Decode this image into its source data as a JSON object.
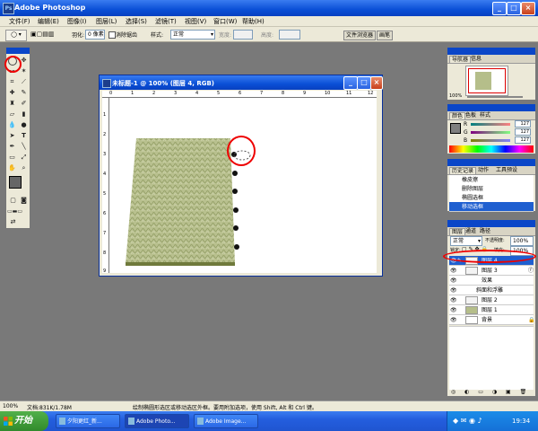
{
  "app": {
    "title": "Adobe Photoshop",
    "icon": "photoshop-logo"
  },
  "menubar": [
    "文件(F)",
    "编辑(E)",
    "图像(I)",
    "图层(L)",
    "选择(S)",
    "滤镜(T)",
    "视图(V)",
    "窗口(W)",
    "帮助(H)"
  ],
  "options": {
    "feather_label": "羽化:",
    "feather_value": "0 像素",
    "antialias_label": "消除锯齿",
    "style_label": "样式:",
    "style_value": "正常",
    "width_label": "宽度:",
    "height_label": "高度:",
    "tab_file_browser": "文件浏览器",
    "tab_brushes": "画笔"
  },
  "document": {
    "title": "未标题-1 @ 100% (图层 4, RGB)",
    "ruler_h": [
      "0",
      "1",
      "2",
      "3",
      "4",
      "5",
      "6",
      "7",
      "8",
      "9",
      "10",
      "11",
      "12"
    ],
    "ruler_v": [
      "1",
      "2",
      "3",
      "4",
      "5",
      "6",
      "7",
      "8",
      "9"
    ]
  },
  "navigator": {
    "tabs": [
      "导航器",
      "信息"
    ],
    "zoom": "100%"
  },
  "color": {
    "tabs": [
      "颜色",
      "色板",
      "样式"
    ],
    "channels": [
      {
        "name": "R",
        "value": "127"
      },
      {
        "name": "G",
        "value": "127"
      },
      {
        "name": "B",
        "value": "127"
      }
    ]
  },
  "history": {
    "tabs": [
      "历史记录",
      "动作",
      "工具预设"
    ],
    "items": [
      "橡皮擦",
      "删除图层",
      "椭圆选框",
      "移动选框"
    ]
  },
  "layers": {
    "tabs": [
      "图层",
      "通道",
      "路径"
    ],
    "blend_mode": "正常",
    "opacity_label": "不透明度:",
    "opacity": "100%",
    "lock_label": "锁定:",
    "fill_label": "填充:",
    "fill": "100%",
    "items": [
      {
        "name": "图层 4",
        "selected": true
      },
      {
        "name": "图层 3"
      },
      {
        "name": "效果"
      },
      {
        "name": "斜面和浮雕"
      },
      {
        "name": "图层 2"
      },
      {
        "name": "图层 1"
      },
      {
        "name": "背景"
      }
    ]
  },
  "status": {
    "zoom": "100%",
    "doc_info": "文档:831K/1.78M",
    "hint": "绘制椭圆形选区或移动选区外框。要用附加选项，使用 Shift, Alt 和 Ctrl 键。"
  },
  "taskbar": {
    "start": "开始",
    "tasks": [
      "夕阳更红_新...",
      "Adobe Photo...",
      "Adobe Image..."
    ],
    "clock": "19:34"
  },
  "colors": {
    "xp_blue": "#0a4fd6",
    "highlight": "#e00000",
    "texture": "#b5be8a"
  }
}
